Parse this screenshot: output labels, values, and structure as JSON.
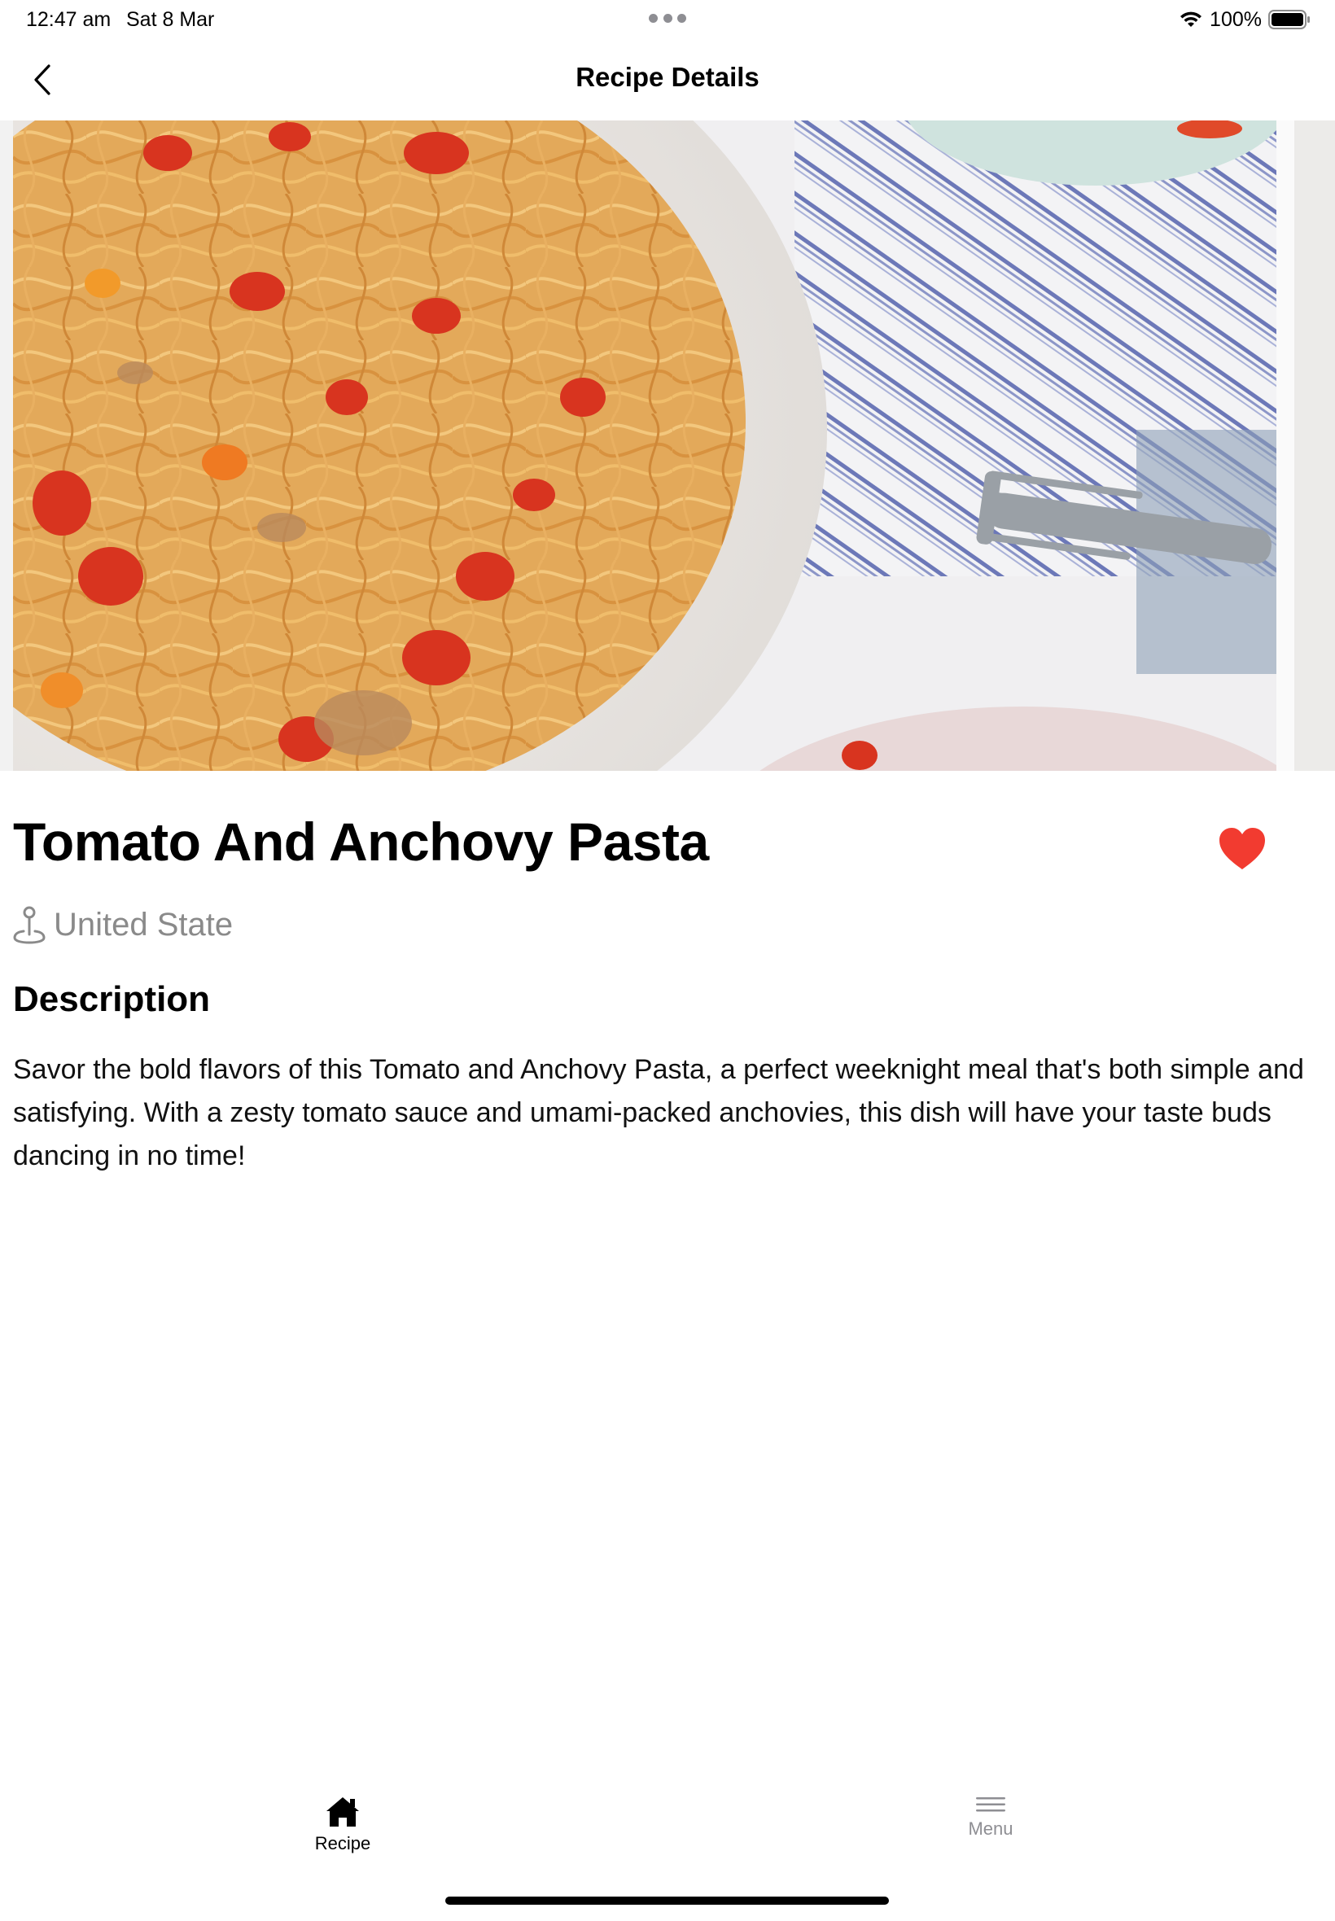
{
  "status_bar": {
    "time": "12:47 am",
    "date": "Sat 8 Mar",
    "battery": "100%",
    "icons": [
      "wifi-icon",
      "battery-icon",
      "multitask-dots-icon"
    ]
  },
  "nav": {
    "title": "Recipe Details",
    "back_icon": "chevron-left-icon"
  },
  "recipe": {
    "image_alt_icon": "pasta-photo",
    "title": "Tomato And Anchovy Pasta",
    "favorite": true,
    "favorite_icon": "heart-icon",
    "location_icon": "location-pin-icon",
    "location": "United State",
    "description_heading": "Description",
    "description": "Savor the bold flavors of this Tomato and Anchovy Pasta, a perfect weeknight meal that's both simple and satisfying. With a zesty tomato sauce and umami-packed anchovies, this dish will have your taste buds dancing in no time!"
  },
  "tab_bar": {
    "tabs": [
      {
        "label": "Recipe",
        "icon": "home-icon",
        "active": true
      },
      {
        "label": "Menu",
        "icon": "menu-icon",
        "active": false
      }
    ]
  },
  "colors": {
    "heart": "#f23b30",
    "secondary_text": "#8a8a8a",
    "inactive_tab": "#8e8e93"
  }
}
